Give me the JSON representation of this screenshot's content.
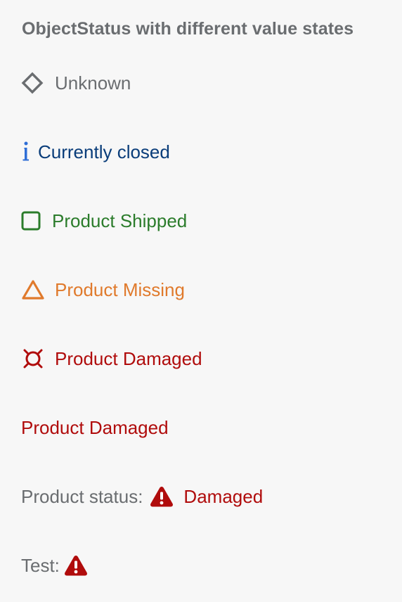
{
  "title": "ObjectStatus with different value states",
  "statuses": [
    {
      "text": "Unknown",
      "state": "None",
      "icon": "diamond-icon",
      "color": "#6a6d70"
    },
    {
      "text": "Currently closed",
      "state": "Information",
      "icon": "information-icon",
      "color": "#0a3d7a"
    },
    {
      "text": "Product Shipped",
      "state": "Success",
      "icon": "square-icon",
      "color": "#2b7c2b"
    },
    {
      "text": "Product Missing",
      "state": "Warning",
      "icon": "triangle-icon",
      "color": "#e07a2c"
    },
    {
      "text": "Product Damaged",
      "state": "Error",
      "icon": "error-sun-icon",
      "color": "#b00c0c"
    },
    {
      "text": "Product Damaged",
      "state": "Error",
      "icon": null,
      "color": "#b00c0c"
    }
  ],
  "product_status": {
    "label": "Product status:",
    "text": "Damaged",
    "icon": "alert-icon",
    "color": "#b00c0c"
  },
  "test": {
    "label": "Test:",
    "icon": "alert-icon",
    "color": "#b00c0c"
  }
}
